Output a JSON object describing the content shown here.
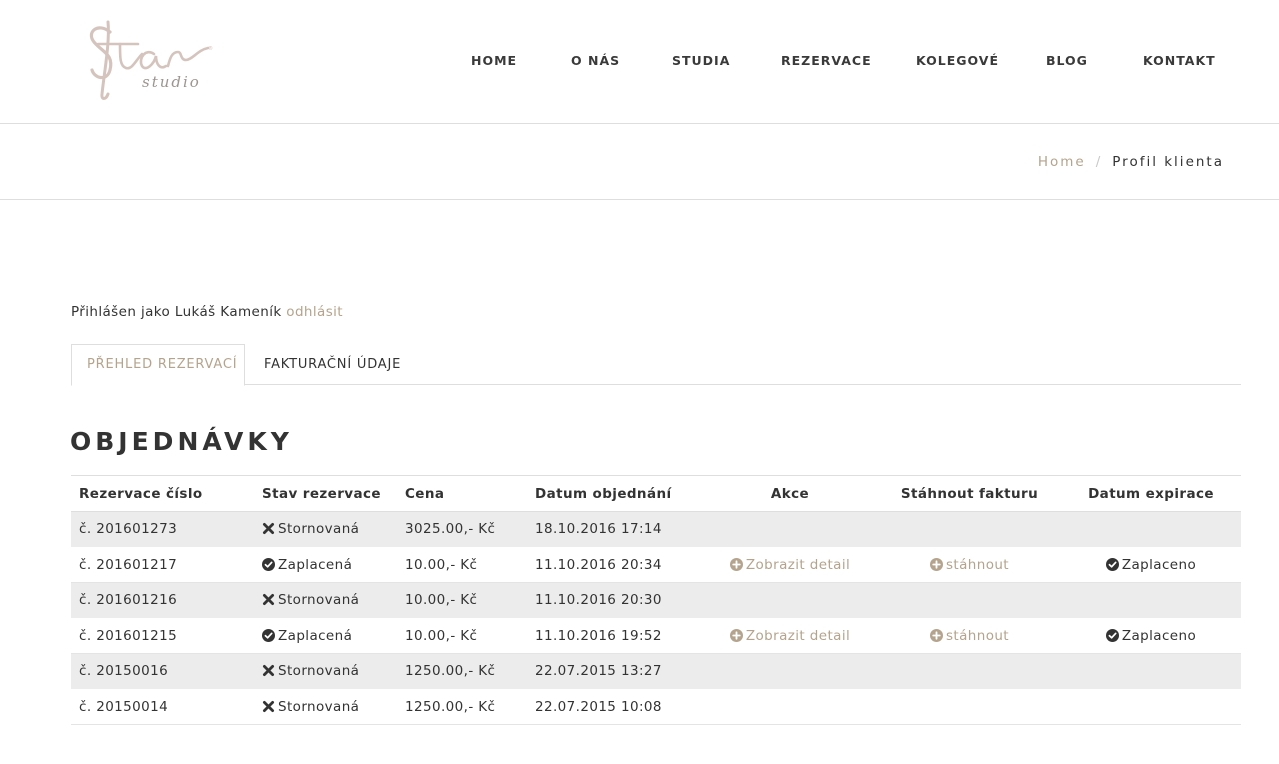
{
  "brand": {
    "logo_main": "Star",
    "logo_sub": "studio",
    "accent_color": "#b4a48d"
  },
  "nav": {
    "items": [
      {
        "label": "HOME"
      },
      {
        "label": "O NÁS"
      },
      {
        "label": "STUDIA"
      },
      {
        "label": "REZERVACE"
      },
      {
        "label": "KOLEGOVÉ"
      },
      {
        "label": "BLOG"
      },
      {
        "label": "KONTAKT"
      }
    ]
  },
  "breadcrumb": {
    "home": "Home",
    "separator": "/",
    "current": "Profil klienta"
  },
  "session": {
    "prefix": "Přihlášen jako Lukáš Kameník",
    "logout": "odhlásit"
  },
  "tabs": [
    {
      "label": "PŘEHLED REZERVACÍ",
      "active": true
    },
    {
      "label": "FAKTURAČNÍ ÚDAJE",
      "active": false
    }
  ],
  "orders": {
    "title": "OBJEDNÁVKY",
    "columns": [
      "Rezervace číslo",
      "Stav rezervace",
      "Cena",
      "Datum objednání",
      "Akce",
      "Stáhnout fakturu",
      "Datum expirace"
    ],
    "rows": [
      {
        "number": "č. 201601273",
        "status_icon": "times-icon",
        "status": "Stornovaná",
        "price": "3025.00,- Kč",
        "date": "18.10.2016 17:14",
        "action": "",
        "invoice": "",
        "expiry": ""
      },
      {
        "number": "č. 201601217",
        "status_icon": "check-circle-icon",
        "status": "Zaplacená",
        "price": "10.00,- Kč",
        "date": "11.10.2016 20:34",
        "action": "Zobrazit detail",
        "invoice": "stáhnout",
        "expiry": "Zaplaceno"
      },
      {
        "number": "č. 201601216",
        "status_icon": "times-icon",
        "status": "Stornovaná",
        "price": "10.00,- Kč",
        "date": "11.10.2016 20:30",
        "action": "",
        "invoice": "",
        "expiry": ""
      },
      {
        "number": "č. 201601215",
        "status_icon": "check-circle-icon",
        "status": "Zaplacená",
        "price": "10.00,- Kč",
        "date": "11.10.2016 19:52",
        "action": "Zobrazit detail",
        "invoice": "stáhnout",
        "expiry": "Zaplaceno"
      },
      {
        "number": "č. 20150016",
        "status_icon": "times-icon",
        "status": "Stornovaná",
        "price": "1250.00,- Kč",
        "date": "22.07.2015 13:27",
        "action": "",
        "invoice": "",
        "expiry": ""
      },
      {
        "number": "č. 20150014",
        "status_icon": "times-icon",
        "status": "Stornovaná",
        "price": "1250.00,- Kč",
        "date": "22.07.2015 10:08",
        "action": "",
        "invoice": "",
        "expiry": ""
      }
    ]
  }
}
